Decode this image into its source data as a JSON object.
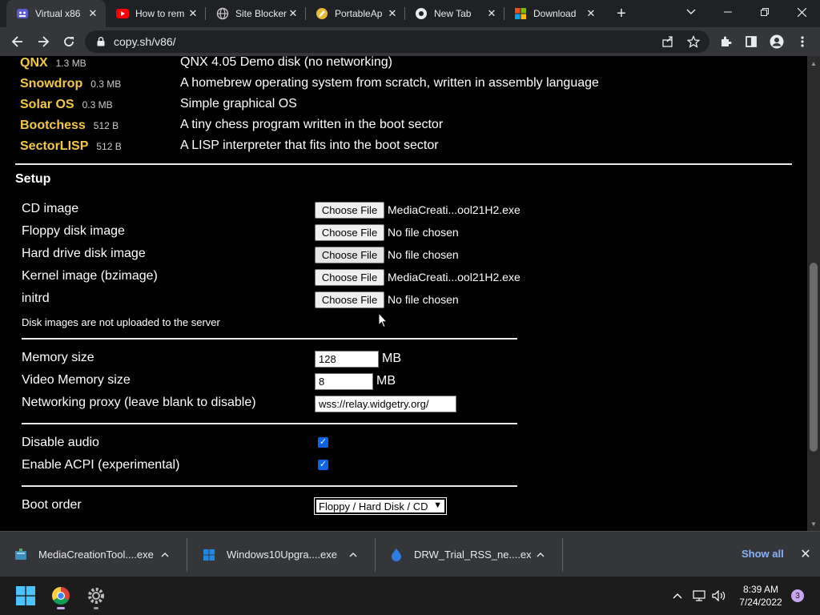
{
  "browser": {
    "tabs": [
      {
        "title": "Virtual x86",
        "icon": "v86-icon",
        "active": true
      },
      {
        "title": "How to rem",
        "icon": "youtube-icon"
      },
      {
        "title": "Site Blocker",
        "icon": "globe-icon"
      },
      {
        "title": "PortableAp",
        "icon": "portableapps-icon"
      },
      {
        "title": "New Tab",
        "icon": "chrome-icon"
      },
      {
        "title": "Download",
        "icon": "microsoft-icon"
      }
    ],
    "url": "copy.sh/v86/"
  },
  "os_list": [
    {
      "name": "QNX",
      "size": "1.3 MB",
      "desc": "QNX 4.05 Demo disk (no networking)"
    },
    {
      "name": "Snowdrop",
      "size": "0.3 MB",
      "desc": "A homebrew operating system from scratch, written in assembly language"
    },
    {
      "name": "Solar OS",
      "size": "0.3 MB",
      "desc": "Simple graphical OS"
    },
    {
      "name": "Bootchess",
      "size": "512 B",
      "desc": "A tiny chess program written in the boot sector"
    },
    {
      "name": "SectorLISP",
      "size": "512 B",
      "desc": "A LISP interpreter that fits into the boot sector"
    }
  ],
  "setup": {
    "title": "Setup",
    "file_inputs": [
      {
        "label": "CD image",
        "button": "Choose File",
        "file": "MediaCreati...ool21H2.exe"
      },
      {
        "label": "Floppy disk image",
        "button": "Choose File",
        "file": "No file chosen"
      },
      {
        "label": "Hard drive disk image",
        "button": "Choose File",
        "file": "No file chosen"
      },
      {
        "label": "Kernel image (bzimage)",
        "button": "Choose File",
        "file": "MediaCreati...ool21H2.exe"
      },
      {
        "label": "initrd",
        "button": "Choose File",
        "file": "No file chosen"
      }
    ],
    "note": "Disk images are not uploaded to the server",
    "memory": {
      "label": "Memory size",
      "value": "128",
      "unit": "MB"
    },
    "video_memory": {
      "label": "Video Memory size",
      "value": "8",
      "unit": "MB"
    },
    "proxy": {
      "label": "Networking proxy (leave blank to disable)",
      "value": "wss://relay.widgetry.org/"
    },
    "disable_audio": {
      "label": "Disable audio",
      "checked": true
    },
    "enable_acpi": {
      "label": "Enable ACPI (experimental)",
      "checked": true
    },
    "boot_order": {
      "label": "Boot order",
      "value": "Floppy / Hard Disk / CD"
    }
  },
  "downloads": {
    "items": [
      {
        "name": "MediaCreationTool....exe",
        "icon": "installer-icon"
      },
      {
        "name": "Windows10Upgra....exe",
        "icon": "windows-icon"
      },
      {
        "name": "DRW_Trial_RSS_ne....exe",
        "icon": "drw-icon"
      }
    ],
    "show_all": "Show all"
  },
  "taskbar": {
    "time": "8:39 AM",
    "date": "7/24/2022",
    "notifications": "3"
  },
  "colors": {
    "os_name": "#f4c842",
    "accent": "#0b63e5",
    "link": "#8ab4f8"
  }
}
